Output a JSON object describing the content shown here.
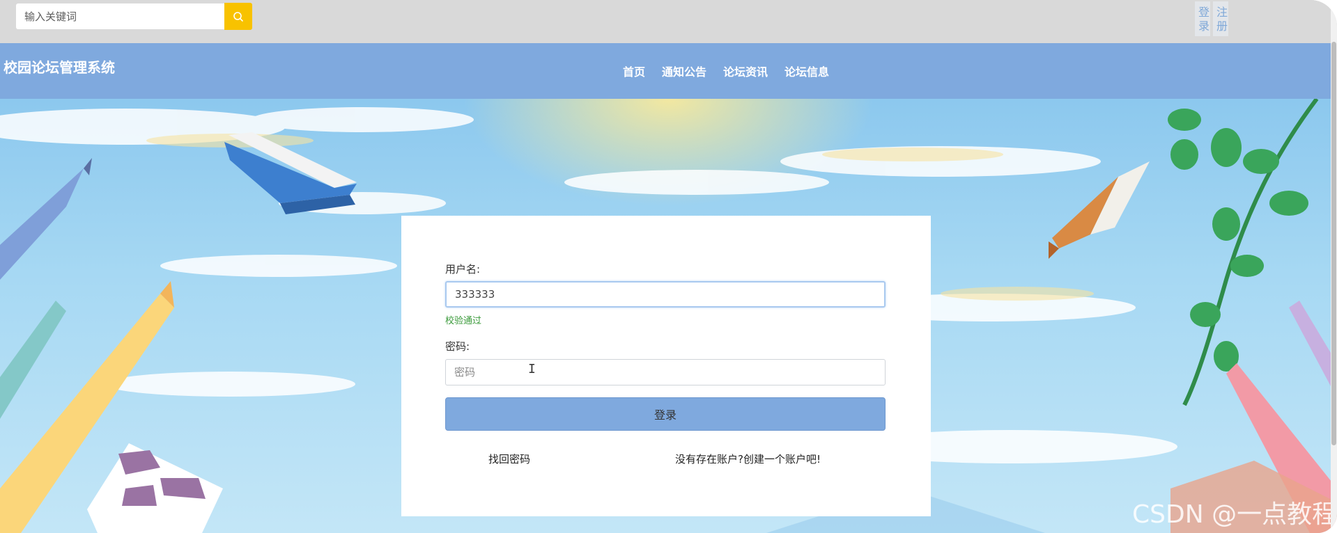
{
  "search": {
    "placeholder": "输入关键词"
  },
  "auth": {
    "login": "登录",
    "register": "注册"
  },
  "nav": {
    "site_title": "校园论坛管理系统",
    "links": [
      "首页",
      "通知公告",
      "论坛资讯",
      "论坛信息"
    ]
  },
  "form": {
    "username_label": "用户名:",
    "username_value": "333333",
    "username_valid": "校验通过",
    "password_label": "密码:",
    "password_placeholder": "密码",
    "submit_label": "登录",
    "forgot_link": "找回密码",
    "register_link": "没有存在账户?创建一个账户吧!"
  },
  "watermark": "CSDN @一点教程",
  "colors": {
    "accent": "#7fa9de",
    "search_button": "#f8c200",
    "valid_text": "#3a9a3a"
  },
  "icons": {
    "search": "search-icon"
  }
}
